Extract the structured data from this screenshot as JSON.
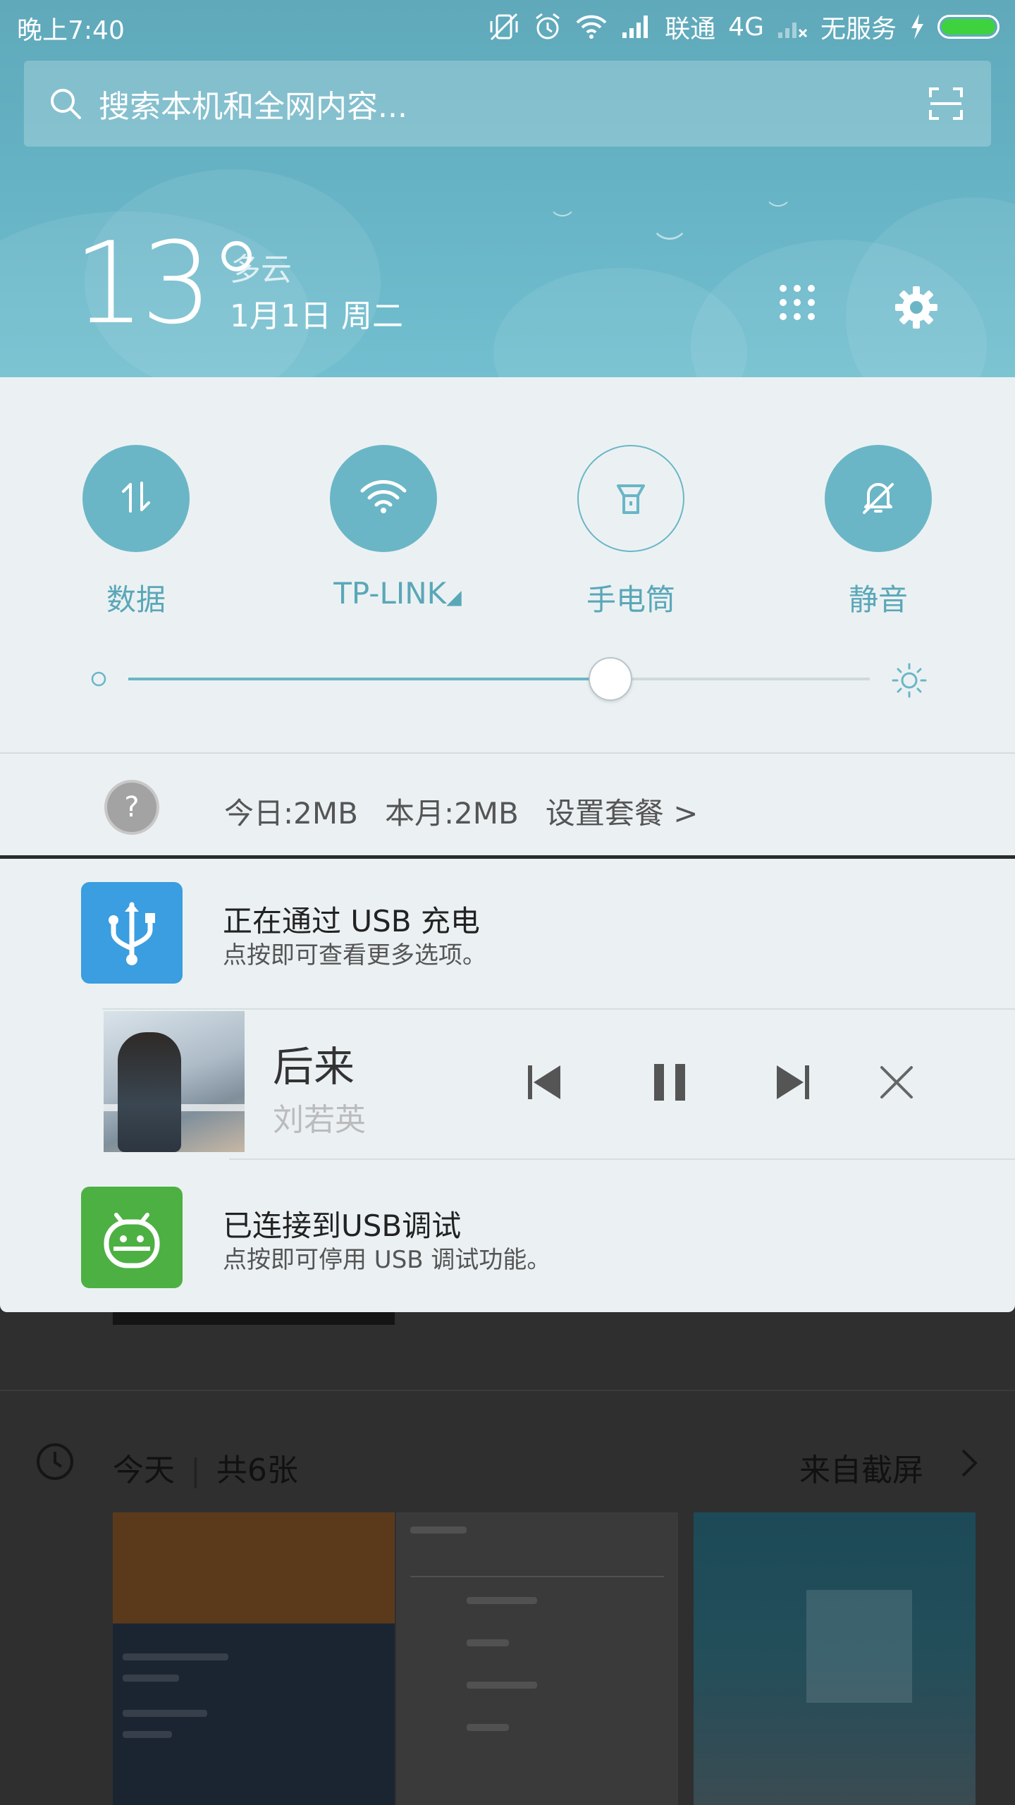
{
  "status_bar": {
    "time": "晚上7:40",
    "carrier": "联通",
    "network": "4G",
    "no_service": "无服务",
    "battery_color": "#3fd23f",
    "icons": [
      "vibrate-off-icon",
      "alarm-icon",
      "wifi-icon",
      "signal-icon",
      "no-signal-icon",
      "charging-icon",
      "battery-icon"
    ]
  },
  "search": {
    "placeholder": "搜索本机和全网内容..."
  },
  "weather": {
    "temperature": "13°",
    "condition": "多云",
    "date": "1月1日 周二"
  },
  "quick_settings": {
    "toggles": [
      {
        "label": "数据",
        "icon": "data-transfer-icon",
        "active": true
      },
      {
        "label": "TP-LINK",
        "icon": "wifi-icon",
        "active": true
      },
      {
        "label": "手电筒",
        "icon": "flashlight-icon",
        "active": false
      },
      {
        "label": "静音",
        "icon": "bell-off-icon",
        "active": true
      }
    ],
    "brightness_level": 0.65
  },
  "data_usage": {
    "today": "今日:2MB",
    "month": "本月:2MB",
    "setup": "设置套餐 >"
  },
  "notifications": {
    "usb_charging": {
      "title": "正在通过 USB 充电",
      "subtitle": "点按即可查看更多选项。",
      "icon_color": "#3a9ee0"
    },
    "music": {
      "title": "后来",
      "artist": "刘若英"
    },
    "usb_debug": {
      "title": "已连接到USB调试",
      "subtitle": "点按即可停用 USB 调试功能。",
      "icon_color": "#4db043"
    }
  },
  "gallery": {
    "today": "今天",
    "count": "共6张",
    "source": "来自截屏"
  },
  "colors": {
    "accent": "#6ab6c6",
    "panel": "#ebf1f3"
  }
}
